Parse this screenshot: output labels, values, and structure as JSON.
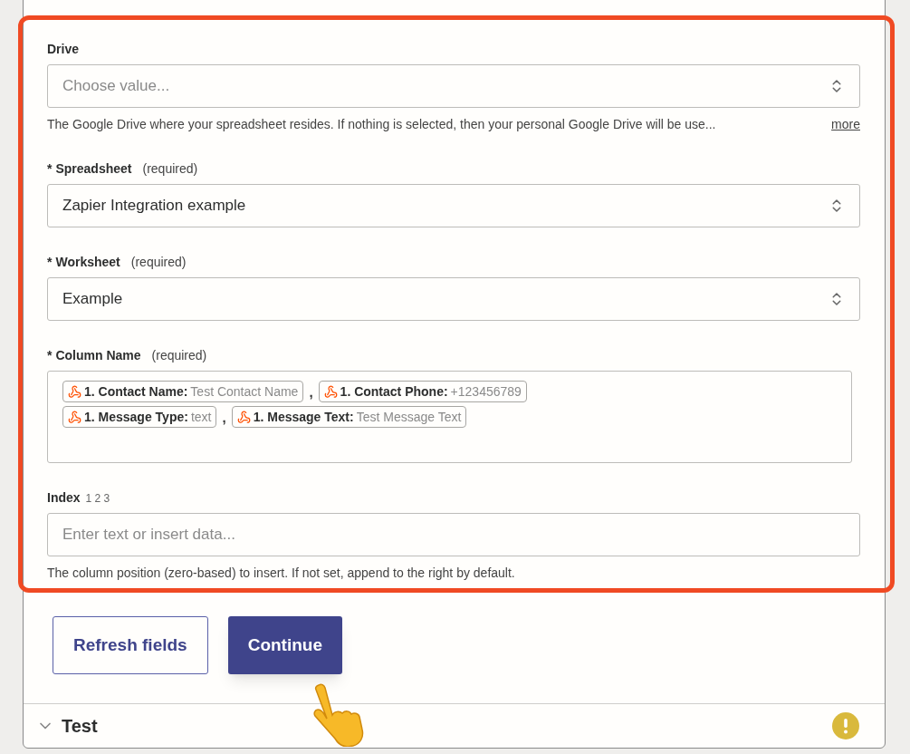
{
  "fields": [
    {
      "kind": "select",
      "label": "Drive",
      "placeholder": "Choose value...",
      "help": "The Google Drive where your spreadsheet resides. If nothing is selected, then your personal Google Drive will be use...",
      "more": "more"
    },
    {
      "kind": "select",
      "marker": "*",
      "label": "Spreadsheet",
      "note": "(required)",
      "value": "Zapier Integration example"
    },
    {
      "kind": "select",
      "marker": "*",
      "label": "Worksheet",
      "note": "(required)",
      "value": "Example"
    },
    {
      "kind": "tokens",
      "marker": "*",
      "label": "Column Name",
      "note": "(required)",
      "tokens": [
        {
          "name": "1. Contact Name:",
          "value": "Test Contact Name",
          "separator": ","
        },
        {
          "name": "1. Contact Phone:",
          "value": "+123456789"
        },
        {
          "name": "1. Message Type:",
          "value": "text",
          "separator": ","
        },
        {
          "name": "1. Message Text:",
          "value": "Test Message Text"
        }
      ]
    },
    {
      "kind": "text",
      "label": "Index",
      "note": "1 2 3",
      "placeholder": "Enter text or insert data...",
      "help": "The column position (zero-based) to insert. If not set, append to the right by default."
    }
  ],
  "buttons": [
    {
      "label": "Refresh fields",
      "kind": "secondary"
    },
    {
      "label": "Continue",
      "kind": "primary"
    }
  ],
  "section": {
    "title": "Test",
    "expanded": false,
    "warning": true
  }
}
